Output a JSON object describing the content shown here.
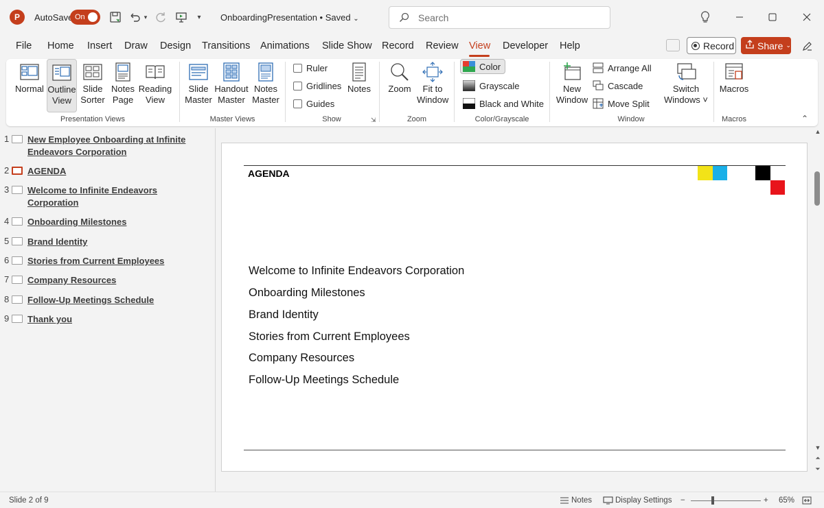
{
  "app": {
    "autosave_label": "AutoSave",
    "autosave_state": "On",
    "doc_title": "OnboardingPresentation • Saved",
    "search_placeholder": "Search",
    "accent_color": "#c43e1c"
  },
  "menu": {
    "tabs": [
      "File",
      "Home",
      "Insert",
      "Draw",
      "Design",
      "Transitions",
      "Animations",
      "Slide Show",
      "Record",
      "Review",
      "View",
      "Developer",
      "Help"
    ],
    "active_tab": "View",
    "record_label": "Record",
    "share_label": "Share"
  },
  "ribbon": {
    "presentation_views": {
      "label": "Presentation Views",
      "normal": "Normal",
      "outline_1": "Outline",
      "outline_2": "View",
      "sorter_1": "Slide",
      "sorter_2": "Sorter",
      "notes_page_1": "Notes",
      "notes_page_2": "Page",
      "reading_1": "Reading",
      "reading_2": "View"
    },
    "master_views": {
      "label": "Master Views",
      "slide_1": "Slide",
      "slide_2": "Master",
      "handout_1": "Handout",
      "handout_2": "Master",
      "notes_1": "Notes",
      "notes_2": "Master"
    },
    "show": {
      "label": "Show",
      "ruler": "Ruler",
      "gridlines": "Gridlines",
      "guides": "Guides",
      "notes": "Notes"
    },
    "zoom": {
      "label": "Zoom",
      "zoom": "Zoom",
      "fit_1": "Fit to",
      "fit_2": "Window"
    },
    "color": {
      "label": "Color/Grayscale",
      "color": "Color",
      "grayscale": "Grayscale",
      "bw": "Black and White"
    },
    "window": {
      "label": "Window",
      "new_1": "New",
      "new_2": "Window",
      "arrange_all": "Arrange All",
      "cascade": "Cascade",
      "move_split": "Move Split",
      "switch_1": "Switch",
      "switch_2": "Windows ˅"
    },
    "macros": {
      "label": "Macros",
      "macros": "Macros"
    }
  },
  "outline": [
    {
      "num": "1",
      "text": "New Employee Onboarding at Infinite Endeavors Corporation"
    },
    {
      "num": "2",
      "text": "AGENDA"
    },
    {
      "num": "3",
      "text": "Welcome to Infinite Endeavors Corporation"
    },
    {
      "num": "4",
      "text": "Onboarding Milestones"
    },
    {
      "num": "5",
      "text": "Brand Identity"
    },
    {
      "num": "6",
      "text": "Stories from Current Employees"
    },
    {
      "num": "7",
      "text": "Company Resources"
    },
    {
      "num": "8",
      "text": "Follow-Up Meetings Schedule"
    },
    {
      "num": "9",
      "text": "Thank you"
    }
  ],
  "slide": {
    "title": "AGENDA",
    "items": [
      "Welcome to Infinite Endeavors Corporation",
      "Onboarding Milestones",
      "Brand Identity",
      "Stories from Current Employees",
      "Company Resources",
      "Follow-Up Meetings Schedule"
    ],
    "accent_squares": {
      "yellow": "#f2e318",
      "cyan": "#1ab0e8",
      "black": "#000000",
      "red": "#e8141b"
    }
  },
  "status": {
    "slide_counter": "Slide 2 of 9",
    "notes": "Notes",
    "display_settings": "Display Settings",
    "zoom_level": "65%"
  }
}
